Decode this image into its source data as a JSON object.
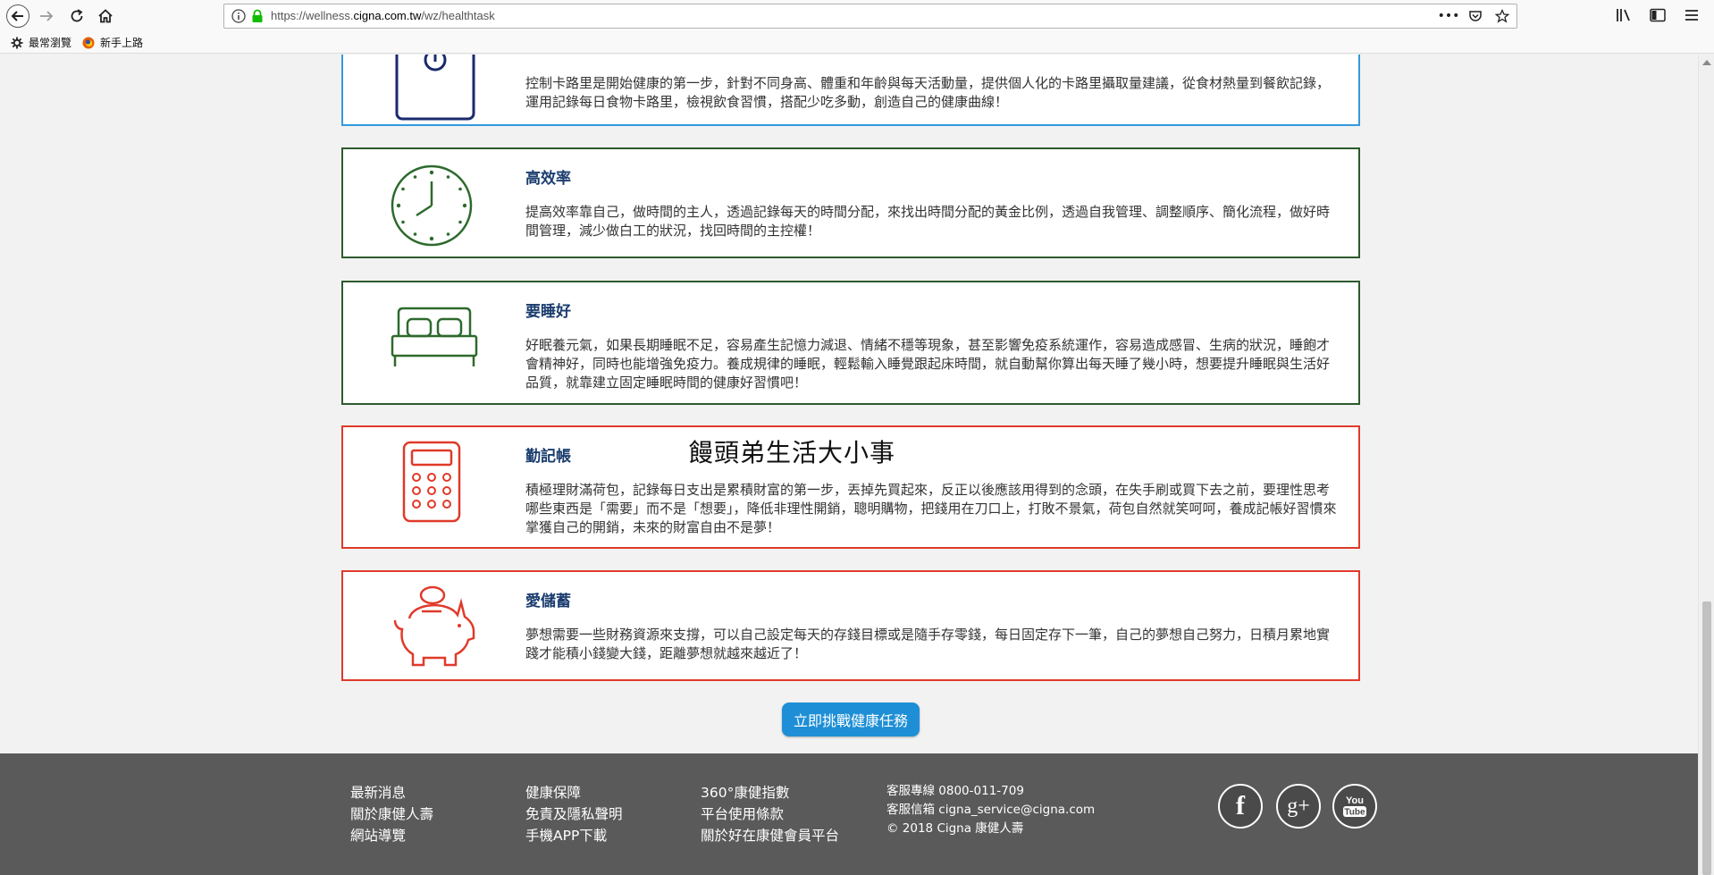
{
  "browser": {
    "url_prefix": "https://wellness.",
    "url_domain": "cigna.com.tw",
    "url_path": "/wz/healthtask",
    "url_actions": [
      "more-icon",
      "pocket-icon",
      "bookmark-star-icon"
    ],
    "right_tools": [
      "library-icon",
      "sidebar-icon",
      "menu-icon"
    ]
  },
  "bookmarks": [
    {
      "label": "最常瀏覽",
      "icon": "gear-icon"
    },
    {
      "label": "新手上路",
      "icon": "firefox-icon"
    }
  ],
  "cards": {
    "calorie": {
      "desc": "控制卡路里是開始健康的第一步，針對不同身高、體重和年齡與每天活動量，提供個人化的卡路里攝取量建議，從食材熱量到餐飲記錄，運用記錄每日食物卡路里，檢視飲食習慣，搭配少吃多動，創造自己的健康曲線！",
      "color": "#3399dd"
    },
    "efficiency": {
      "title": "高效率",
      "desc": "提高效率靠自己，做時間的主人，透過記錄每天的時間分配，來找出時間分配的黃金比例，透過自我管理、調整順序、簡化流程，做好時間管理，減少做白工的狀況，找回時間的主控權！",
      "color": "#2d5a2d"
    },
    "sleep": {
      "title": "要睡好",
      "desc": "好眠養元氣，如果長期睡眠不足，容易產生記憶力減退、情緒不穩等現象，甚至影響免疫系統運作，容易造成感冒、生病的狀況，睡飽才會精神好，同時也能增強免疫力。養成規律的睡眠，輕鬆輸入睡覺跟起床時間，就自動幫你算出每天睡了幾小時，想要提升睡眠與生活好品質，就靠建立固定睡眠時間的健康好習慣吧！",
      "color": "#2d5a2d"
    },
    "bookkeeping": {
      "title": "勤記帳",
      "desc": "積極理財滿荷包，記錄每日支出是累積財富的第一步，丟掉先買起來，反正以後應該用得到的念頭，在失手刷或買下去之前，要理性思考哪些東西是「需要」而不是「想要」，降低非理性開銷，聰明購物，把錢用在刀口上，打敗不景氣，荷包自然就笑呵呵，養成記帳好習慣來掌獲自己的開銷，未來的財富自由不是夢！",
      "color": "#e03a2a"
    },
    "saving": {
      "title": "愛儲蓄",
      "desc": "夢想需要一些財務資源來支撐，可以自己設定每天的存錢目標或是隨手存零錢，每日固定存下一筆，自己的夢想自己努力，日積月累地實踐才能積小錢變大錢，距離夢想就越來越近了！",
      "color": "#e03a2a"
    }
  },
  "watermark": "饅頭弟生活大小事",
  "cta": "立即挑戰健康任務",
  "footer": {
    "col1": [
      "最新消息",
      "關於康健人壽",
      "網站導覽"
    ],
    "col2": [
      "健康保障",
      "免責及隱私聲明",
      "手機APP下載"
    ],
    "col3": [
      "360°康健指數",
      "平台使用條款",
      "關於好在康健會員平台"
    ],
    "contact": [
      "客服專線 0800-011-709",
      "客服信箱 cigna_service@cigna.com",
      "© 2018 Cigna 康健人壽"
    ],
    "social": [
      "facebook-icon",
      "google-plus-icon",
      "youtube-icon"
    ]
  }
}
